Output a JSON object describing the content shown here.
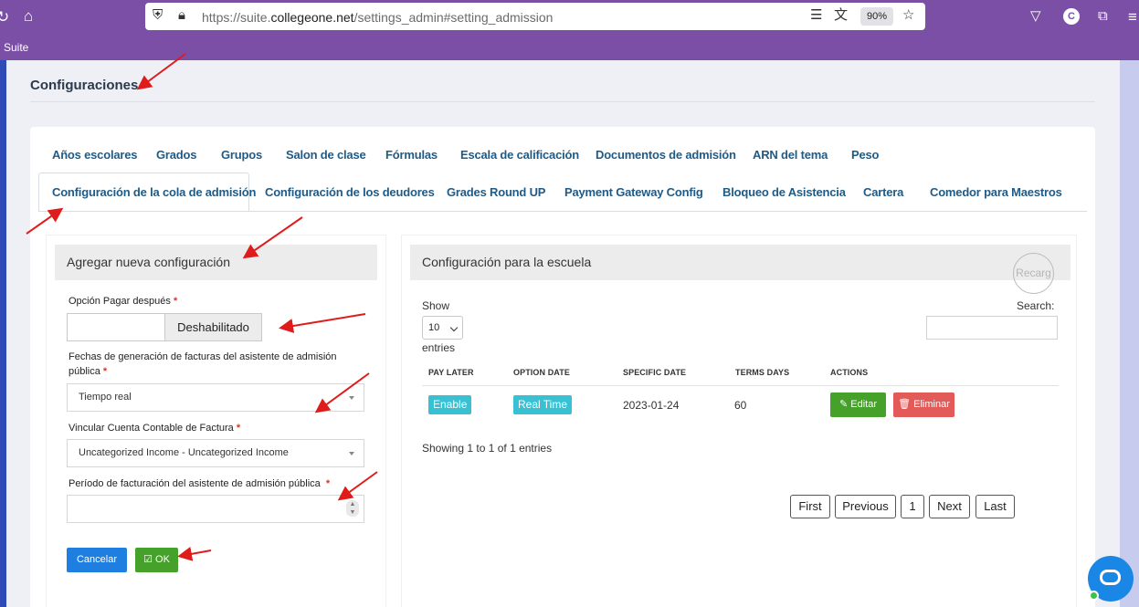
{
  "browser": {
    "url_prefix": "https://suite.",
    "url_domain": "collegeone.net",
    "url_suffix": "/settings_admin#setting_admission",
    "zoom": "90%",
    "bookmark": "Suite",
    "profile_initial": "C"
  },
  "page": {
    "title": "Configuraciones"
  },
  "tabs_row1": [
    "Años escolares",
    "Grados",
    "Grupos",
    "Salon de clase",
    "Fórmulas",
    "Escala de calificación",
    "Documentos de admisión",
    "ARN del tema",
    "Peso"
  ],
  "tabs_row2": [
    "Configuración de la cola de admisión",
    "Configuración de los deudores",
    "Grades Round UP",
    "Payment Gateway Config",
    "Bloqueo de Asistencia",
    "Cartera",
    "Comedor para Maestros"
  ],
  "form": {
    "heading": "Agregar nueva configuración",
    "pay_later_label": "Opción Pagar después",
    "pay_later_value": "Deshabilitado",
    "invoice_dates_label_1": "Fechas de generación de facturas del asistente de admisión",
    "invoice_dates_label_2": "pública",
    "invoice_dates_value": "Tiempo real",
    "account_label": "Vincular Cuenta Contable de Factura",
    "account_value": "Uncategorized Income - Uncategorized Income",
    "period_label": "Período de facturación del asistente de admisión pública",
    "period_value": "",
    "required_mark": "*",
    "cancel_label": "Cancelar",
    "ok_label": "OK"
  },
  "school_config": {
    "heading": "Configuración para la escuela",
    "reload_label": "Recarg",
    "show_label": "Show",
    "page_length": "10",
    "entries_label": "entries",
    "search_label": "Search:",
    "columns": [
      "PAY LATER",
      "OPTION DATE",
      "SPECIFIC DATE",
      "TERMS DAYS",
      "ACTIONS"
    ],
    "rows": [
      {
        "pay_later": "Enable",
        "option_date": "Real Time",
        "specific_date": "2023-01-24",
        "terms_days": "60",
        "edit": "Editar",
        "delete": "Eliminar"
      }
    ],
    "info": "Showing 1 to 1 of 1 entries",
    "pager": [
      "First",
      "Previous",
      "1",
      "Next",
      "Last"
    ]
  },
  "colors": {
    "browser_purple": "#7b4fa6",
    "tab_blue": "#1f5b86",
    "primary_blue": "#1f7fe0",
    "success_green": "#45a12a",
    "danger_red": "#e25b58",
    "info_cyan": "#37c1d2",
    "annotation_red": "#e01b1b"
  }
}
